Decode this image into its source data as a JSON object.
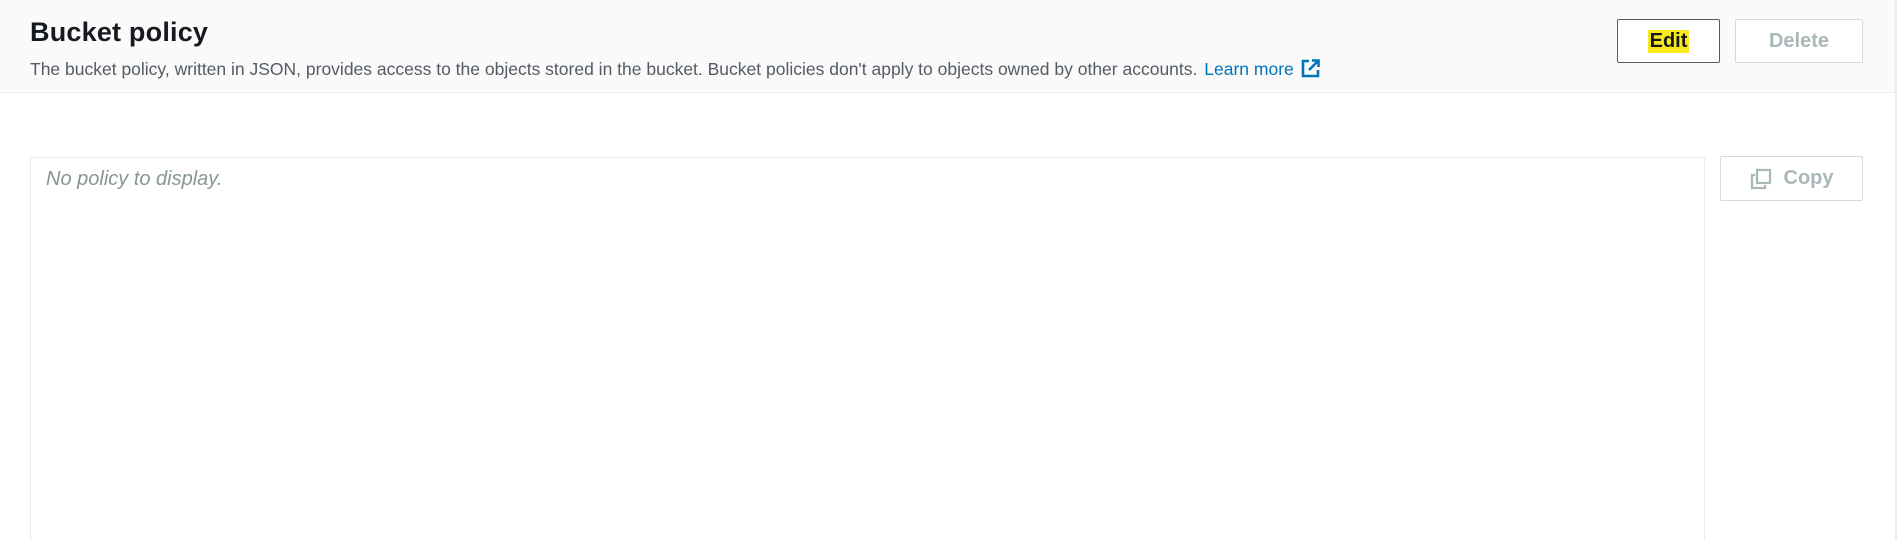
{
  "section": {
    "title": "Bucket policy",
    "description": "The bucket policy, written in JSON, provides access to the objects stored in the bucket. Bucket policies don't apply to objects owned by other accounts.",
    "learn_more_label": "Learn more"
  },
  "actions": {
    "edit_label": "Edit",
    "delete_label": "Delete",
    "copy_label": "Copy"
  },
  "policy": {
    "empty_text": "No policy to display."
  },
  "colors": {
    "link": "#0073bb",
    "edit_highlight": "#f7e81f",
    "disabled_text": "#aab7b8",
    "placeholder_text": "#879596"
  },
  "icons": {
    "learn_more": "external-link-icon",
    "copy": "copy-icon"
  }
}
